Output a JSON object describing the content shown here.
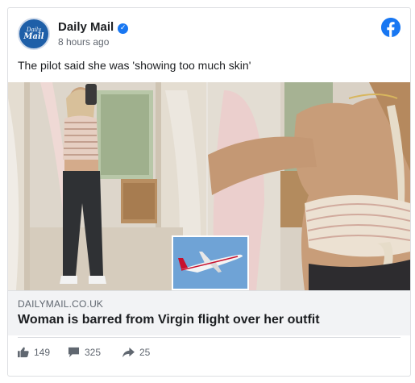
{
  "post": {
    "page_name": "Daily Mail",
    "avatar_text_line1": "Daily",
    "avatar_text_line2": "Mail",
    "timestamp": "8 hours ago",
    "text": "The pilot said she was 'showing too much skin'"
  },
  "link_preview": {
    "domain": "DAILYMAIL.CO.UK",
    "headline": "Woman is barred from Virgin flight over her outfit"
  },
  "reactions": {
    "likes": "149",
    "comments": "325",
    "shares": "25"
  },
  "icons": {
    "verified": "verified-badge-icon",
    "facebook": "facebook-logo-icon",
    "like": "thumbs-up-icon",
    "comment": "comment-bubble-icon",
    "share": "share-arrow-icon"
  },
  "colors": {
    "facebook_blue": "#1877f2",
    "daily_mail_blue": "#1e5fa8",
    "link_bg": "#f2f3f5"
  }
}
